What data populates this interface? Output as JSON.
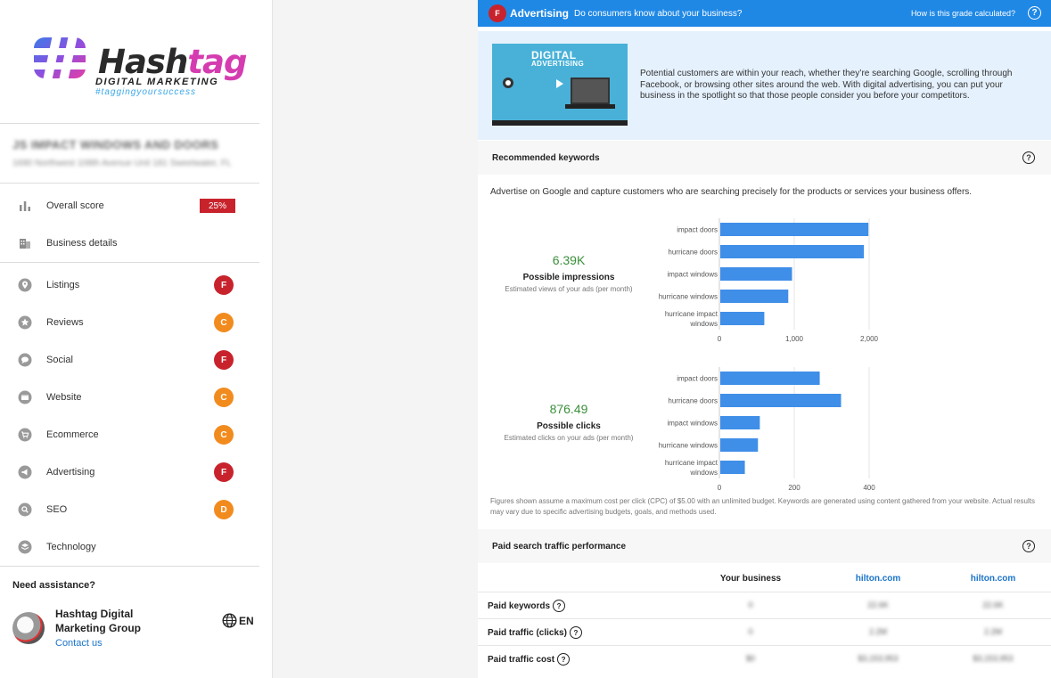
{
  "sidebar": {
    "logo": {
      "word_dark": "Hash",
      "word_accent": "tag",
      "subtitle": "DIGITAL MARKETING",
      "tagline": "#taggingyoursuccess"
    },
    "business": {
      "name": "JS IMPACT WINDOWS AND DOORS",
      "address": "1690 Northwest 108th Avenue Unit 181 Sweetwater, FL"
    },
    "overall": {
      "label": "Overall score",
      "score": "25%"
    },
    "details_label": "Business details",
    "items": [
      {
        "label": "Listings",
        "grade": "F"
      },
      {
        "label": "Reviews",
        "grade": "C"
      },
      {
        "label": "Social",
        "grade": "F"
      },
      {
        "label": "Website",
        "grade": "C"
      },
      {
        "label": "Ecommerce",
        "grade": "C"
      },
      {
        "label": "Advertising",
        "grade": "F"
      },
      {
        "label": "SEO",
        "grade": "D"
      },
      {
        "label": "Technology",
        "grade": ""
      }
    ],
    "assist": {
      "title": "Need assistance?",
      "name": "Hashtag Digital Marketing Group",
      "contact": "Contact us",
      "lang": "EN"
    }
  },
  "main": {
    "grade": "F",
    "title": "Advertising",
    "subtitle": "Do consumers know about your business?",
    "how": "How is this grade calculated?",
    "thumb": {
      "line1": "DIGITAL",
      "line2": "ADVERTISING"
    },
    "intro": "Potential customers are within your reach, whether they’re searching Google, scrolling through Facebook, or browsing other sites around the web. With digital advertising, you can put your business in the spotlight so that those people consider you before your competitors.",
    "keywords_title": "Recommended keywords",
    "keywords_desc": "Advertise on Google and capture customers who are searching precisely for the products or services your business offers.",
    "impressions": {
      "value": "6.39K",
      "label": "Possible impressions",
      "sub": "Estimated views of your ads (per month)"
    },
    "clicks": {
      "value": "876.49",
      "label": "Possible clicks",
      "sub": "Estimated clicks on your ads (per month)"
    },
    "footnote": "Figures shown assume a maximum cost per click (CPC) of $5.00 with an unlimited budget. Keywords are generated using content gathered from your website. Actual results may vary due to specific advertising budgets, goals, and methods used.",
    "paid_title": "Paid search traffic performance",
    "table": {
      "headers": [
        "Your business",
        "hilton.com",
        "hilton.com"
      ],
      "rows": [
        {
          "label": "Paid keywords",
          "cells": [
            "0",
            "22.6K",
            "22.6K"
          ]
        },
        {
          "label": "Paid traffic (clicks)",
          "cells": [
            "0",
            "2.2M",
            "2.2M"
          ]
        },
        {
          "label": "Paid traffic cost",
          "cells": [
            "$0",
            "$3,153,953",
            "$3,153,953"
          ]
        }
      ]
    }
  },
  "chart_data": [
    {
      "type": "bar",
      "orientation": "horizontal",
      "categories": [
        "impact doors",
        "hurricane doors",
        "impact windows",
        "hurricane windows",
        "hurricane impact windows"
      ],
      "values": [
        1990,
        1930,
        970,
        920,
        600
      ],
      "xlim": [
        0,
        2000
      ],
      "ticks": [
        0,
        1000,
        2000
      ],
      "tick_labels": [
        "0",
        "1,000",
        "2,000"
      ],
      "color": "#3f8ee8"
    },
    {
      "type": "bar",
      "orientation": "horizontal",
      "categories": [
        "impact doors",
        "hurricane doors",
        "impact windows",
        "hurricane windows",
        "hurricane impact windows"
      ],
      "values": [
        268,
        325,
        108,
        103,
        68
      ],
      "xlim": [
        0,
        400
      ],
      "ticks": [
        0,
        200,
        400
      ],
      "tick_labels": [
        "0",
        "200",
        "400"
      ],
      "color": "#3f8ee8"
    }
  ]
}
